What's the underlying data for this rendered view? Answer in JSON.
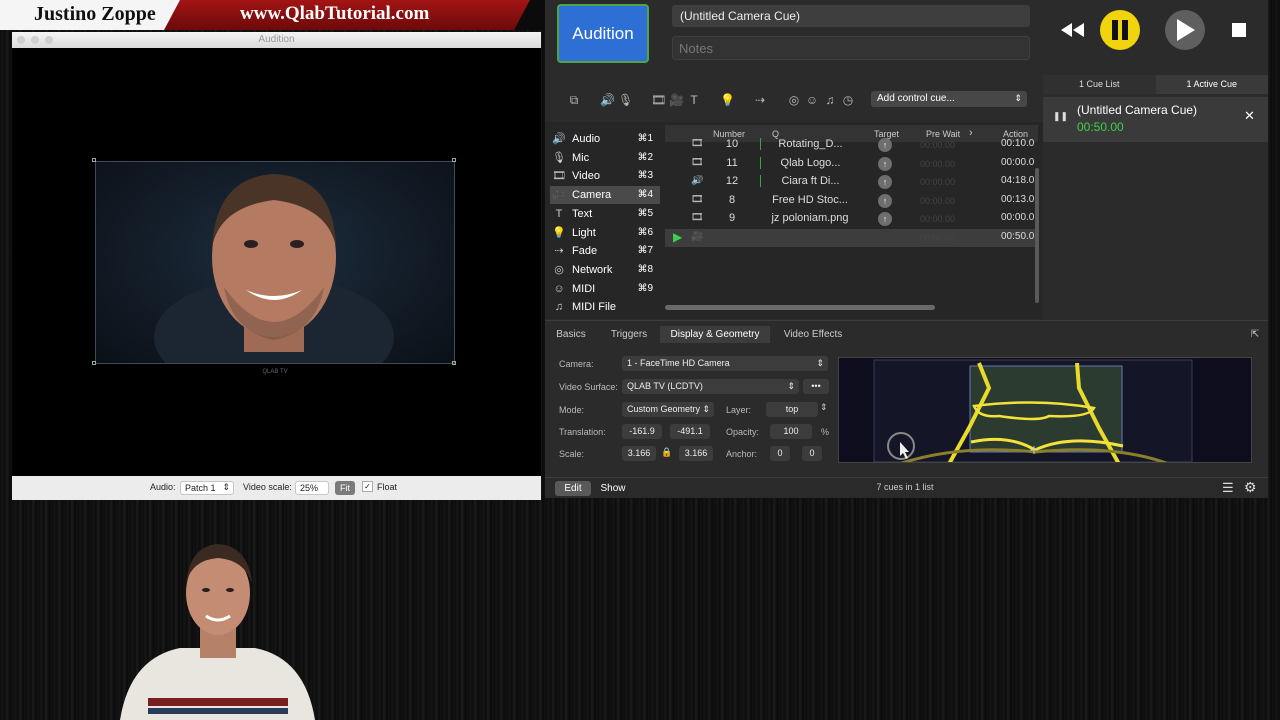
{
  "banner": {
    "presenter_name": "Justino Zoppe",
    "site_url": "www.QlabTutorial.com"
  },
  "audition": {
    "title": "Audition",
    "surface_label": "QLAB TV",
    "footer": {
      "audio_label": "Audio:",
      "audio_value": "Patch 1",
      "video_scale_label": "Video scale:",
      "video_scale_value": "25%",
      "fit_label": "Fit",
      "float_label": "Float"
    }
  },
  "qlab": {
    "cue_type": "Audition",
    "cue_name": "(Untitled Camera Cue)",
    "notes_placeholder": "Notes",
    "add_control_cue": "Add control cue...",
    "right_tabs": [
      "1 Cue List",
      "1 Active Cue"
    ],
    "active_cue": {
      "name": "(Untitled Camera Cue)",
      "time": "00:50.00"
    },
    "sidebar": [
      {
        "icon": "speaker-icon",
        "glyph": "🔊",
        "label": "Audio",
        "key": "⌘1"
      },
      {
        "icon": "mic-icon",
        "glyph": "🎙",
        "label": "Mic",
        "key": "⌘2"
      },
      {
        "icon": "film-icon",
        "glyph": "🎞",
        "label": "Video",
        "key": "⌘3"
      },
      {
        "icon": "camera-icon",
        "glyph": "🎥",
        "label": "Camera",
        "key": "⌘4"
      },
      {
        "icon": "text-icon",
        "glyph": "T",
        "label": "Text",
        "key": "⌘5"
      },
      {
        "icon": "bulb-icon",
        "glyph": "💡",
        "label": "Light",
        "key": "⌘6"
      },
      {
        "icon": "fade-icon",
        "glyph": "⇢",
        "label": "Fade",
        "key": "⌘7"
      },
      {
        "icon": "network-icon",
        "glyph": "◎",
        "label": "Network",
        "key": "⌘8"
      },
      {
        "icon": "midi-icon",
        "glyph": "☺",
        "label": "MIDI",
        "key": "⌘9"
      },
      {
        "icon": "music-note-icon",
        "glyph": "♫",
        "label": "MIDI File",
        "key": ""
      }
    ],
    "table_headers": {
      "number": "Number",
      "q": "Q",
      "target": "Target",
      "pre_wait": "Pre Wait",
      "action": "Action"
    },
    "cues": [
      {
        "icon": "film-icon",
        "glyph": "🎞",
        "number": "10",
        "name": "Rotating_D...",
        "pre_wait": "00:00.00",
        "action": "00:10.0"
      },
      {
        "icon": "film-icon",
        "glyph": "🎞",
        "number": "11",
        "name": "Qlab Logo...",
        "pre_wait": "00:00.00",
        "action": "00:00.0"
      },
      {
        "icon": "speaker-icon",
        "glyph": "🔊",
        "number": "12",
        "name": "Ciara ft Di...",
        "pre_wait": "00:00.00",
        "action": "04:18.0"
      },
      {
        "icon": "film-icon",
        "glyph": "🎞",
        "number": "8",
        "name": "Free HD Stoc...",
        "pre_wait": "00:00.00",
        "action": "00:13.0"
      },
      {
        "icon": "film-icon",
        "glyph": "🎞",
        "number": "9",
        "name": "jz poloniam.png",
        "pre_wait": "00:00.00",
        "action": "00:00.0"
      },
      {
        "icon": "camera-icon",
        "glyph": "🎥",
        "number": "",
        "name": "",
        "pre_wait": "00:00.00",
        "action": "00:50.0"
      }
    ],
    "inspector_tabs": [
      "Basics",
      "Triggers",
      "Display & Geometry",
      "Video Effects"
    ],
    "geometry": {
      "camera_label": "Camera:",
      "camera_value": "1 - FaceTime HD Camera",
      "surface_label": "Video Surface:",
      "surface_value": "QLAB TV  (LCDTV)",
      "mode_label": "Mode:",
      "mode_value": "Custom Geometry",
      "layer_label": "Layer:",
      "layer_value": "top",
      "translation_label": "Translation:",
      "translation_x": "-161.9",
      "translation_y": "-491.1",
      "opacity_label": "Opacity:",
      "opacity_value": "100",
      "opacity_unit": "%",
      "scale_label": "Scale:",
      "scale_x": "3.166",
      "scale_y": "3.166",
      "anchor_label": "Anchor:",
      "anchor_x": "0",
      "anchor_y": "0"
    },
    "bottom": {
      "edit": "Edit",
      "show": "Show",
      "cue_count": "7 cues in 1 list"
    }
  }
}
